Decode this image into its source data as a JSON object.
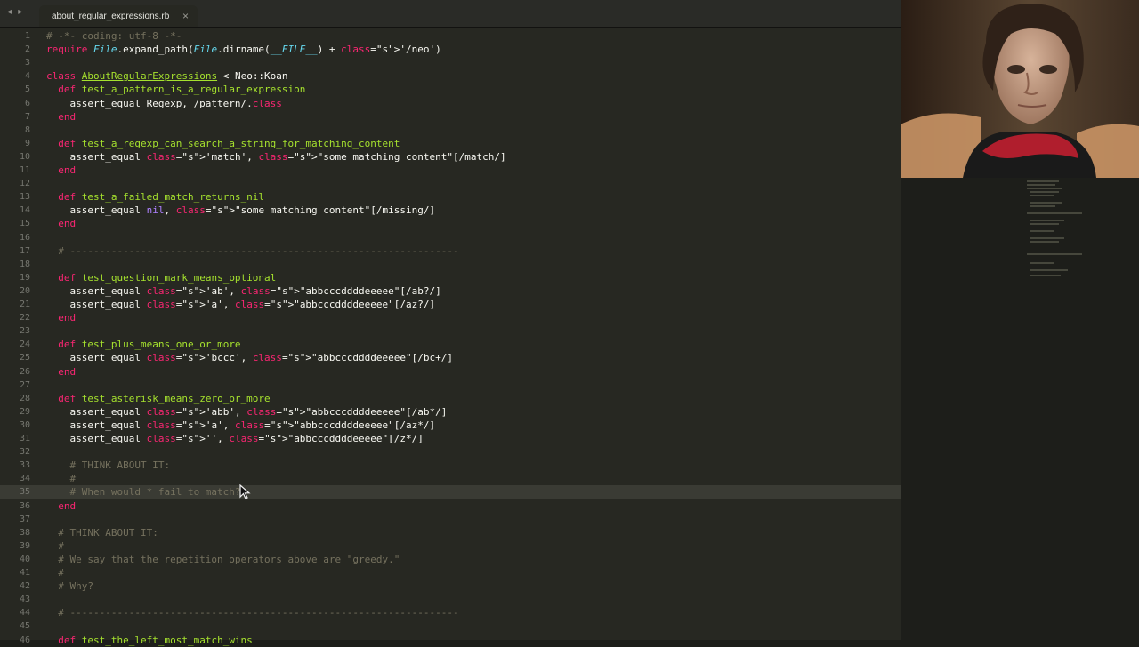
{
  "window": {
    "nav_arrows": "◂ ▸",
    "tab": {
      "title": "about_regular_expressions.rb",
      "close": "×"
    }
  },
  "editor": {
    "lines": [
      {
        "n": "1",
        "text": "# -*- coding: utf-8 -*-"
      },
      {
        "n": "2",
        "text": "require File.expand_path(File.dirname(__FILE__) + '/neo')"
      },
      {
        "n": "3",
        "text": ""
      },
      {
        "n": "4",
        "text": "class AboutRegularExpressions < Neo::Koan"
      },
      {
        "n": "5",
        "text": "  def test_a_pattern_is_a_regular_expression"
      },
      {
        "n": "6",
        "text": "    assert_equal Regexp, /pattern/.class"
      },
      {
        "n": "7",
        "text": "  end"
      },
      {
        "n": "8",
        "text": ""
      },
      {
        "n": "9",
        "text": "  def test_a_regexp_can_search_a_string_for_matching_content"
      },
      {
        "n": "10",
        "text": "    assert_equal 'match', \"some matching content\"[/match/]"
      },
      {
        "n": "11",
        "text": "  end"
      },
      {
        "n": "12",
        "text": ""
      },
      {
        "n": "13",
        "text": "  def test_a_failed_match_returns_nil"
      },
      {
        "n": "14",
        "text": "    assert_equal nil, \"some matching content\"[/missing/]"
      },
      {
        "n": "15",
        "text": "  end"
      },
      {
        "n": "16",
        "text": ""
      },
      {
        "n": "17",
        "text": "  # ------------------------------------------------------------------"
      },
      {
        "n": "18",
        "text": ""
      },
      {
        "n": "19",
        "text": "  def test_question_mark_means_optional"
      },
      {
        "n": "20",
        "text": "    assert_equal 'ab', \"abbcccddddeeeee\"[/ab?/]"
      },
      {
        "n": "21",
        "text": "    assert_equal 'a', \"abbcccddddeeeee\"[/az?/]"
      },
      {
        "n": "22",
        "text": "  end"
      },
      {
        "n": "23",
        "text": ""
      },
      {
        "n": "24",
        "text": "  def test_plus_means_one_or_more"
      },
      {
        "n": "25",
        "text": "    assert_equal 'bccc', \"abbcccddddeeeee\"[/bc+/]"
      },
      {
        "n": "26",
        "text": "  end"
      },
      {
        "n": "27",
        "text": ""
      },
      {
        "n": "28",
        "text": "  def test_asterisk_means_zero_or_more"
      },
      {
        "n": "29",
        "text": "    assert_equal 'abb', \"abbcccddddeeeee\"[/ab*/]"
      },
      {
        "n": "30",
        "text": "    assert_equal 'a', \"abbcccddddeeeee\"[/az*/]"
      },
      {
        "n": "31",
        "text": "    assert_equal '', \"abbcccddddeeeee\"[/z*/]"
      },
      {
        "n": "32",
        "text": ""
      },
      {
        "n": "33",
        "text": "    # THINK ABOUT IT:"
      },
      {
        "n": "34",
        "text": "    #"
      },
      {
        "n": "35",
        "text": "    # When would * fail to match?"
      },
      {
        "n": "36",
        "text": "  end"
      },
      {
        "n": "37",
        "text": ""
      },
      {
        "n": "38",
        "text": "  # THINK ABOUT IT:"
      },
      {
        "n": "39",
        "text": "  #"
      },
      {
        "n": "40",
        "text": "  # We say that the repetition operators above are \"greedy.\""
      },
      {
        "n": "41",
        "text": "  #"
      },
      {
        "n": "42",
        "text": "  # Why?"
      },
      {
        "n": "43",
        "text": ""
      },
      {
        "n": "44",
        "text": "  # ------------------------------------------------------------------"
      },
      {
        "n": "45",
        "text": ""
      },
      {
        "n": "46",
        "text": "  def test_the_left_most_match_wins"
      }
    ]
  },
  "colors": {
    "background": "#272822",
    "keyword": "#f92672",
    "string": "#e6db74",
    "comment": "#75715e",
    "function": "#a6e22e",
    "constant": "#66d9ef",
    "nil": "#ae81ff"
  }
}
